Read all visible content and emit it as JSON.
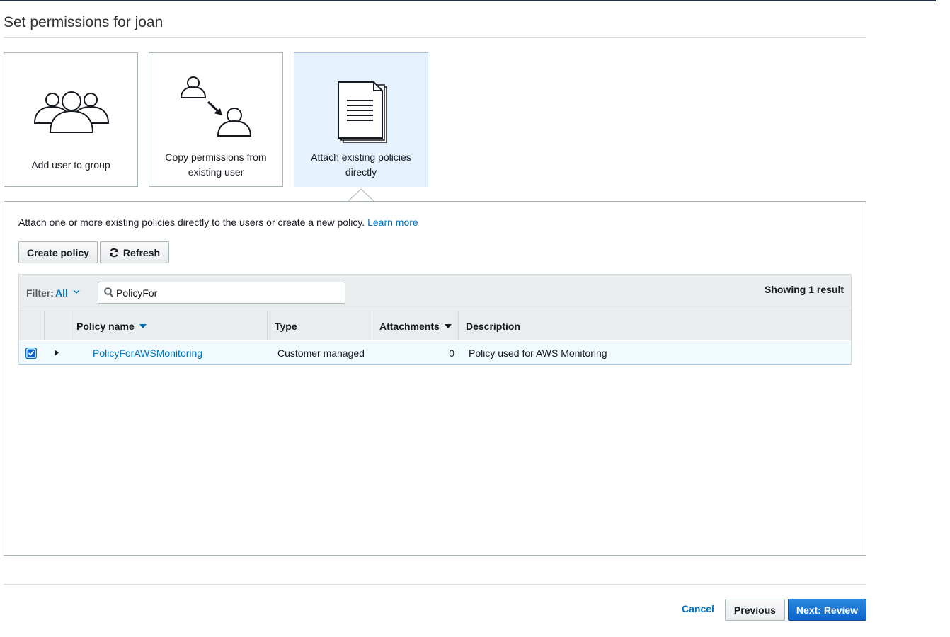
{
  "page": {
    "title": "Set permissions for joan"
  },
  "options": [
    {
      "label": "Add user to group",
      "icon": "users-group-icon",
      "selected": false
    },
    {
      "label": "Copy permissions from existing user",
      "icon": "copy-user-icon",
      "selected": false
    },
    {
      "label": "Attach existing policies directly",
      "icon": "policy-document-icon",
      "selected": true
    }
  ],
  "panel": {
    "intro": "Attach one or more existing policies directly to the users or create a new policy.",
    "learn_more": "Learn more",
    "create_policy_label": "Create policy",
    "refresh_label": "Refresh"
  },
  "table": {
    "filter_label": "Filter:",
    "filter_value": "All",
    "search_value": "PolicyFor",
    "showing": "Showing 1 result",
    "columns": {
      "policy_name": "Policy name",
      "type": "Type",
      "attachments": "Attachments",
      "description": "Description"
    },
    "rows": [
      {
        "checked": true,
        "policy_name": "PolicyForAWSMonitoring",
        "type": "Customer managed",
        "attachments": "0",
        "description": "Policy used for AWS Monitoring"
      }
    ]
  },
  "footer": {
    "cancel": "Cancel",
    "previous": "Previous",
    "next": "Next: Review"
  },
  "colors": {
    "link": "#0073bb",
    "primary": "#0b63c9",
    "selected_bg": "#e5f2fd",
    "header_bg": "#eaeded"
  }
}
